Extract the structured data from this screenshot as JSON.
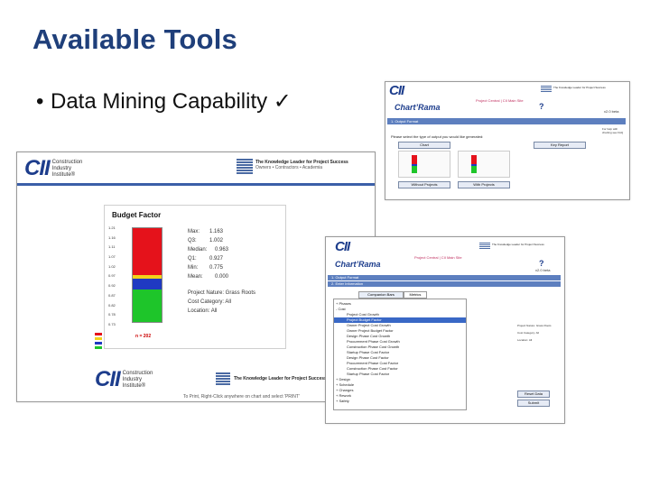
{
  "slide": {
    "title": "Available Tools",
    "bullet": "Data Mining Capability ✓"
  },
  "budget_shot": {
    "brand": "CII",
    "brand_sub": [
      "Construction",
      "Industry",
      "Institute®"
    ],
    "tagline": "The Knowledge Leader for Project Success",
    "tagline2": "Owners • Contractors • Academia",
    "chart_title": "Budget Factor",
    "axis_ticks": [
      "1.21",
      "1.16",
      "1.11",
      "1.07",
      "1.02",
      "0.97",
      "0.92",
      "0.87",
      "0.82",
      "0.78",
      "0.73"
    ],
    "stats": [
      {
        "label": "Max:",
        "value": "1.163"
      },
      {
        "label": "Q3:",
        "value": "1.002"
      },
      {
        "label": "Median:",
        "value": "0.963"
      },
      {
        "label": "Q1:",
        "value": "0.927"
      },
      {
        "label": "Min:",
        "value": "0.775"
      },
      {
        "label": "Mean:",
        "value": "0.000"
      }
    ],
    "nature": "Project Nature: Grass Roots",
    "category": "Cost Category: All",
    "location": "Location: All",
    "n_label": "n = 202",
    "footer_brand": "CII",
    "footer_sub": [
      "Construction",
      "Industry",
      "Institute®"
    ],
    "footer_tagline": "The Knowledge Leader for Project Success",
    "print_note": "To Print, Right-Click anywhere on chart and select 'PRINT'"
  },
  "top_shot": {
    "brand": "CII",
    "tagline": "The Knowledge Leader for Project Success",
    "links": "Project Central | CII Main Site",
    "app": "Chart’Rama",
    "help": "?",
    "version": "v2.0 beta",
    "step": "1. Output Format",
    "subline": "Please select the type of output you would like generated:",
    "chart_btn": "Chart",
    "key_btn": "Key Report",
    "without_btn": "Without Projects",
    "with_btn": "With Projects",
    "side_note": "For help with charting see FAQ"
  },
  "mid_shot": {
    "brand": "CII",
    "tagline": "The Knowledge Leader for Project Success",
    "links": "Project Central | CII Main Site",
    "app": "Chart’Rama",
    "help": "?",
    "version": "v2.0 beta",
    "step1": "1. Output Format",
    "step2": "2. Enter Information",
    "tab1": "Companion Bars",
    "tab2": "Metrics",
    "tree": [
      {
        "text": "+ Phases",
        "indent": 0,
        "sel": false
      },
      {
        "text": "- Cost",
        "indent": 0,
        "sel": false
      },
      {
        "text": "Project Cost Growth",
        "indent": 2,
        "sel": false
      },
      {
        "text": "Project Budget Factor",
        "indent": 2,
        "sel": true
      },
      {
        "text": "Owner Project Cost Growth",
        "indent": 2,
        "sel": false
      },
      {
        "text": "Owner Project Budget Factor",
        "indent": 2,
        "sel": false
      },
      {
        "text": "Design Phase Cost Growth",
        "indent": 2,
        "sel": false
      },
      {
        "text": "Procurement Phase Cost Growth",
        "indent": 2,
        "sel": false
      },
      {
        "text": "Construction Phase Cost Growth",
        "indent": 2,
        "sel": false
      },
      {
        "text": "Startup Phase Cost Factor",
        "indent": 2,
        "sel": false
      },
      {
        "text": "Design Phase Cost Factor",
        "indent": 2,
        "sel": false
      },
      {
        "text": "Procurement Phase Cost Factor",
        "indent": 2,
        "sel": false
      },
      {
        "text": "Construction Phase Cost Factor",
        "indent": 2,
        "sel": false
      },
      {
        "text": "Startup Phase Cost Factor",
        "indent": 2,
        "sel": false
      },
      {
        "text": "+ Design",
        "indent": 0,
        "sel": false
      },
      {
        "text": "+ Schedule",
        "indent": 0,
        "sel": false
      },
      {
        "text": "+ Changes",
        "indent": 0,
        "sel": false
      },
      {
        "text": "+ Rework",
        "indent": 0,
        "sel": false
      },
      {
        "text": "+ Safety",
        "indent": 0,
        "sel": false
      }
    ],
    "right_info": [
      "Project Nature: Grass Roots",
      "Cost Category: All",
      "Location: All"
    ],
    "reset_btn": "Reset Data",
    "submit_btn": "Submit"
  }
}
